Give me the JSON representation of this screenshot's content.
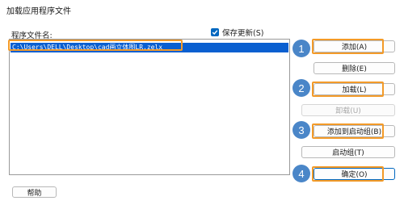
{
  "dialog": {
    "title": "加载应用程序文件",
    "list_label": "程序文件名:",
    "save_update_label": "保存更新(S)",
    "save_update_checked": true,
    "files": [
      "C:\\Users\\DELL\\Desktop\\cad画立体图LR.zelx"
    ]
  },
  "buttons": {
    "add": "添加(A)",
    "delete": "删除(E)",
    "load": "加载(L)",
    "unload": "卸载(U)",
    "add_to_startup": "添加到启动组(B)",
    "startup_group": "启动组(T)",
    "ok": "确定(O)",
    "help": "帮助"
  },
  "callouts": [
    "1",
    "2",
    "3",
    "4"
  ],
  "colors": {
    "accent": "#0067c0",
    "highlight": "#f39a28",
    "badge": "#4a86c8",
    "selection": "#0a5fd0"
  }
}
